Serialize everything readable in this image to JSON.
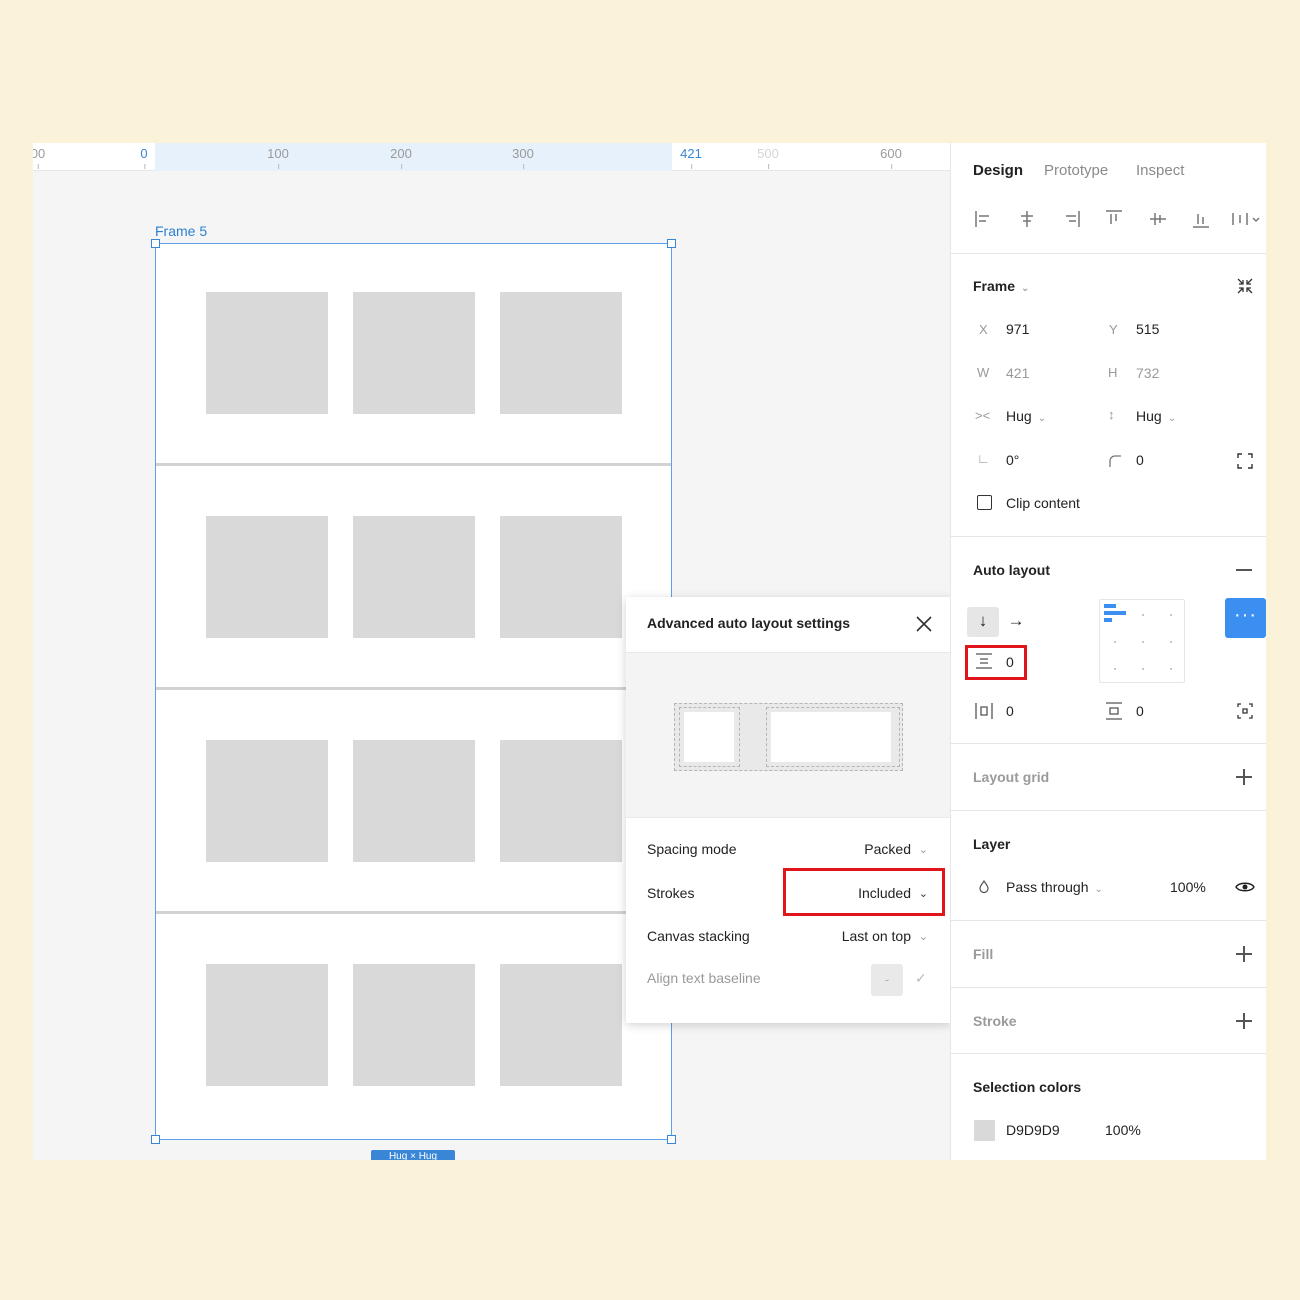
{
  "ruler": {
    "ticks": [
      "00",
      "0",
      "100",
      "200",
      "300",
      "421",
      "500",
      "600"
    ]
  },
  "canvas": {
    "frame_label": "Frame 5",
    "hug_label": "Hug × Hug"
  },
  "popup": {
    "title": "Advanced auto layout settings",
    "rows": [
      {
        "label": "Spacing mode",
        "value": "Packed"
      },
      {
        "label": "Strokes",
        "value": "Included"
      },
      {
        "label": "Canvas stacking",
        "value": "Last on top"
      },
      {
        "label": "Align text baseline",
        "value": "-"
      }
    ]
  },
  "panel": {
    "tabs": [
      "Design",
      "Prototype",
      "Inspect"
    ],
    "frame": {
      "title": "Frame",
      "x_label": "X",
      "x": "971",
      "y_label": "Y",
      "y": "515",
      "w_label": "W",
      "w": "421",
      "h_label": "H",
      "h": "732",
      "hug_h": "Hug",
      "hug_v": "Hug",
      "rotation": "0°",
      "radius": "0",
      "clip_content": "Clip content"
    },
    "auto_layout": {
      "title": "Auto layout",
      "item_spacing": "0",
      "padding_h": "0",
      "padding_v": "0",
      "more": "···"
    },
    "layout_grid": {
      "title": "Layout grid"
    },
    "layer": {
      "title": "Layer",
      "blend": "Pass through",
      "opacity": "100%"
    },
    "fill": {
      "title": "Fill"
    },
    "stroke": {
      "title": "Stroke"
    },
    "selection_colors": {
      "title": "Selection colors",
      "hex": "D9D9D9",
      "opacity": "100%"
    }
  },
  "colors": {
    "accent": "#3b8ff0",
    "highlight_box": "#e1141b",
    "placeholder": "#d9d9d9"
  }
}
